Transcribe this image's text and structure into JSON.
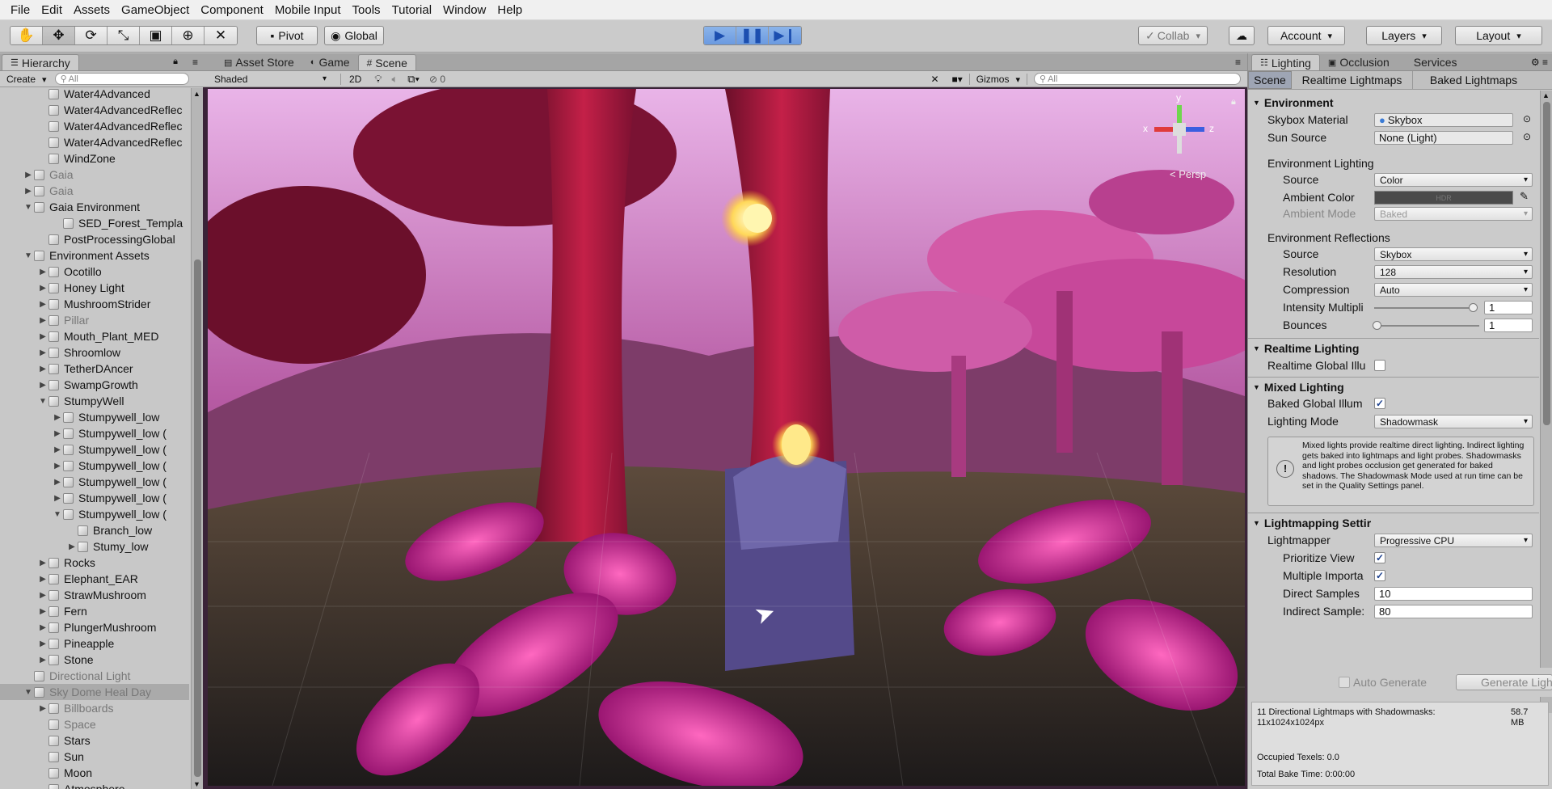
{
  "menu": [
    "File",
    "Edit",
    "Assets",
    "GameObject",
    "Component",
    "Mobile Input",
    "Tools",
    "Tutorial",
    "Window",
    "Help"
  ],
  "toolbar": {
    "pivot": "Pivot",
    "global": "Global",
    "collab": "Collab",
    "account": "Account",
    "layers": "Layers",
    "layout": "Layout"
  },
  "hierarchy": {
    "tab": "Hierarchy",
    "create": "Create",
    "search_placeholder": "All",
    "rows": [
      {
        "label": "Water4Advanced",
        "indent": 3,
        "arrow": "",
        "gray": false
      },
      {
        "label": "Water4AdvancedReflec",
        "indent": 3,
        "arrow": "",
        "gray": false
      },
      {
        "label": "Water4AdvancedReflec",
        "indent": 3,
        "arrow": "",
        "gray": false
      },
      {
        "label": "Water4AdvancedReflec",
        "indent": 3,
        "arrow": "",
        "gray": false
      },
      {
        "label": "WindZone",
        "indent": 3,
        "arrow": "",
        "gray": false
      },
      {
        "label": "Gaia",
        "indent": 2,
        "arrow": "▶",
        "gray": true
      },
      {
        "label": "Gaia",
        "indent": 2,
        "arrow": "▶",
        "gray": true
      },
      {
        "label": "Gaia Environment",
        "indent": 2,
        "arrow": "▼",
        "gray": false
      },
      {
        "label": "SED_Forest_Templa",
        "indent": 4,
        "arrow": "",
        "gray": false
      },
      {
        "label": "PostProcessingGlobal",
        "indent": 3,
        "arrow": "",
        "gray": false
      },
      {
        "label": "Environment Assets",
        "indent": 2,
        "arrow": "▼",
        "gray": false
      },
      {
        "label": "Ocotillo",
        "indent": 3,
        "arrow": "▶",
        "gray": false
      },
      {
        "label": "Honey Light",
        "indent": 3,
        "arrow": "▶",
        "gray": false
      },
      {
        "label": "MushroomStrider",
        "indent": 3,
        "arrow": "▶",
        "gray": false
      },
      {
        "label": "Pillar",
        "indent": 3,
        "arrow": "▶",
        "gray": true
      },
      {
        "label": "Mouth_Plant_MED",
        "indent": 3,
        "arrow": "▶",
        "gray": false
      },
      {
        "label": "Shroomlow",
        "indent": 3,
        "arrow": "▶",
        "gray": false
      },
      {
        "label": "TetherDAncer",
        "indent": 3,
        "arrow": "▶",
        "gray": false
      },
      {
        "label": "SwampGrowth",
        "indent": 3,
        "arrow": "▶",
        "gray": false
      },
      {
        "label": "StumpyWell",
        "indent": 3,
        "arrow": "▼",
        "gray": false
      },
      {
        "label": "Stumpywell_low",
        "indent": 4,
        "arrow": "▶",
        "gray": false
      },
      {
        "label": "Stumpywell_low (",
        "indent": 4,
        "arrow": "▶",
        "gray": false
      },
      {
        "label": "Stumpywell_low (",
        "indent": 4,
        "arrow": "▶",
        "gray": false
      },
      {
        "label": "Stumpywell_low (",
        "indent": 4,
        "arrow": "▶",
        "gray": false
      },
      {
        "label": "Stumpywell_low (",
        "indent": 4,
        "arrow": "▶",
        "gray": false
      },
      {
        "label": "Stumpywell_low (",
        "indent": 4,
        "arrow": "▶",
        "gray": false
      },
      {
        "label": "Stumpywell_low (",
        "indent": 4,
        "arrow": "▼",
        "gray": false
      },
      {
        "label": "Branch_low",
        "indent": 5,
        "arrow": "",
        "gray": false
      },
      {
        "label": "Stumy_low",
        "indent": 5,
        "arrow": "▶",
        "gray": false
      },
      {
        "label": "Rocks",
        "indent": 3,
        "arrow": "▶",
        "gray": false
      },
      {
        "label": "Elephant_EAR",
        "indent": 3,
        "arrow": "▶",
        "gray": false
      },
      {
        "label": "StrawMushroom",
        "indent": 3,
        "arrow": "▶",
        "gray": false
      },
      {
        "label": "Fern",
        "indent": 3,
        "arrow": "▶",
        "gray": false
      },
      {
        "label": "PlungerMushroom",
        "indent": 3,
        "arrow": "▶",
        "gray": false
      },
      {
        "label": "Pineapple",
        "indent": 3,
        "arrow": "▶",
        "gray": false
      },
      {
        "label": "Stone",
        "indent": 3,
        "arrow": "▶",
        "gray": false
      },
      {
        "label": "Directional Light",
        "indent": 2,
        "arrow": "",
        "gray": true
      },
      {
        "label": "Sky Dome Heal Day",
        "indent": 2,
        "arrow": "▼",
        "gray": true,
        "selected": true
      },
      {
        "label": "Billboards",
        "indent": 3,
        "arrow": "▶",
        "gray": true
      },
      {
        "label": "Space",
        "indent": 3,
        "arrow": "",
        "gray": true
      },
      {
        "label": "Stars",
        "indent": 3,
        "arrow": "",
        "gray": false
      },
      {
        "label": "Sun",
        "indent": 3,
        "arrow": "",
        "gray": false
      },
      {
        "label": "Moon",
        "indent": 3,
        "arrow": "",
        "gray": false
      },
      {
        "label": "Atmosphere",
        "indent": 3,
        "arrow": "",
        "gray": false
      }
    ]
  },
  "center_tabs": {
    "asset_store": "Asset Store",
    "game": "Game",
    "scene": "Scene"
  },
  "scene_bar": {
    "shading": "Shaded",
    "two_d": "2D",
    "fx_count": "0",
    "gizmos": "Gizmos",
    "search_placeholder": "All"
  },
  "gizmo": {
    "y": "y",
    "x": "x",
    "z": "z",
    "persp": "< Persp"
  },
  "lighting": {
    "tabs": {
      "lighting": "Lighting",
      "occlusion": "Occlusion",
      "services": "Services"
    },
    "subtabs": {
      "scene": "Scene",
      "realtime": "Realtime Lightmaps",
      "baked": "Baked Lightmaps"
    },
    "environment": {
      "header": "Environment",
      "skybox_label": "Skybox Material",
      "skybox_value": "Skybox",
      "sun_label": "Sun Source",
      "sun_value": "None (Light)",
      "env_lighting": "Environment Lighting",
      "source_label": "Source",
      "source_value": "Color",
      "ambient_color_label": "Ambient Color",
      "ambient_color_tag": "HDR",
      "ambient_mode_label": "Ambient Mode",
      "ambient_mode_value": "Baked",
      "env_reflections": "Environment Reflections",
      "refl_source_label": "Source",
      "refl_source_value": "Skybox",
      "resolution_label": "Resolution",
      "resolution_value": "128",
      "compression_label": "Compression",
      "compression_value": "Auto",
      "intensity_label": "Intensity Multipli",
      "intensity_value": "1",
      "bounces_label": "Bounces",
      "bounces_value": "1"
    },
    "realtime": {
      "header": "Realtime Lighting",
      "gi_label": "Realtime Global Illu"
    },
    "mixed": {
      "header": "Mixed Lighting",
      "baked_gi_label": "Baked Global Illum",
      "mode_label": "Lighting Mode",
      "mode_value": "Shadowmask",
      "info": "Mixed lights provide realtime direct lighting. Indirect lighting gets baked into lightmaps and light probes. Shadowmasks and light probes occlusion get generated for baked shadows. The Shadowmask Mode used at run time can be set in the Quality Settings panel."
    },
    "lightmapping": {
      "header": "Lightmapping Settir",
      "lightmapper_label": "Lightmapper",
      "lightmapper_value": "Progressive CPU",
      "prioritize_label": "Prioritize View",
      "multiple_label": "Multiple Importa",
      "direct_label": "Direct Samples",
      "direct_value": "10",
      "indirect_label": "Indirect Sample:",
      "indirect_value": "80"
    },
    "auto_generate": "Auto Generate",
    "generate_button": "Generate Light",
    "stats": {
      "line1": "11 Directional Lightmaps with Shadowmasks:",
      "line2": "11x1024x1024px",
      "size": "58.7 MB",
      "texels": "Occupied Texels: 0.0",
      "bake_time": "Total Bake Time: 0:00:00"
    }
  }
}
